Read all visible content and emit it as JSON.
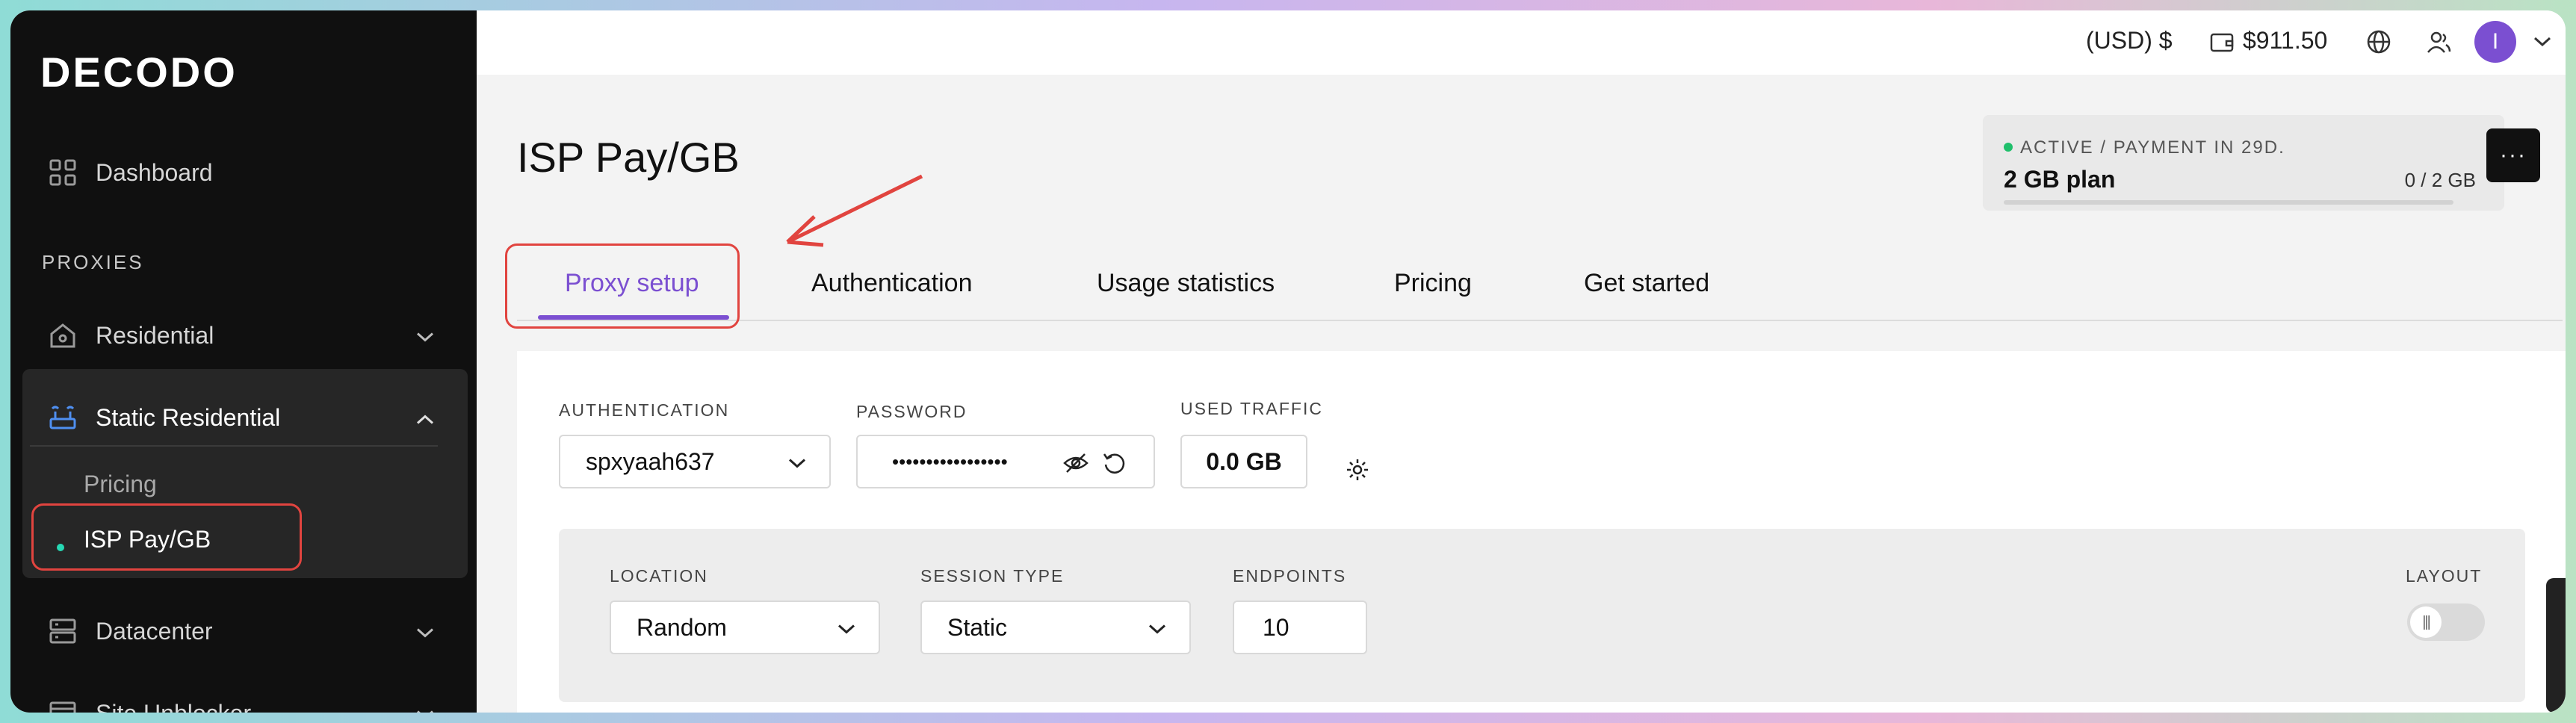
{
  "brand": {
    "logo_text": "DECODO"
  },
  "sidebar": {
    "dashboard_label": "Dashboard",
    "section_label": "PROXIES",
    "items": [
      {
        "label": "Residential"
      },
      {
        "label": "Static Residential"
      },
      {
        "label": "Datacenter"
      },
      {
        "label": "Site Unblocker"
      }
    ],
    "sub_items": [
      {
        "label": "Pricing"
      },
      {
        "label": "ISP Pay/GB"
      }
    ]
  },
  "topbar": {
    "currency": "(USD) $",
    "balance": "$911.50",
    "avatar_letter": "I"
  },
  "page": {
    "title": "ISP Pay/GB",
    "plan": {
      "status": "ACTIVE / PAYMENT IN 29D.",
      "name": "2 GB plan",
      "usage": "0 / 2 GB",
      "usage_fraction": 0
    },
    "more_label": "···",
    "tabs": [
      {
        "label": "Proxy setup"
      },
      {
        "label": "Authentication"
      },
      {
        "label": "Usage statistics"
      },
      {
        "label": "Pricing"
      },
      {
        "label": "Get started"
      }
    ]
  },
  "setup": {
    "authentication": {
      "label": "AUTHENTICATION",
      "value": "spxyaah637"
    },
    "password": {
      "label": "PASSWORD",
      "value": "•••••••••••••••••"
    },
    "used_traffic": {
      "label": "USED TRAFFIC",
      "value": "0.0 GB"
    }
  },
  "filters": {
    "location": {
      "label": "LOCATION",
      "value": "Random"
    },
    "session_type": {
      "label": "SESSION TYPE",
      "value": "Static"
    },
    "endpoints": {
      "label": "ENDPOINTS",
      "value": "10"
    },
    "layout": {
      "label": "LAYOUT"
    }
  },
  "colors": {
    "accent": "#7b4fd1",
    "sidebar_bg": "#101010",
    "highlight_red": "#e1443f",
    "active_dot": "#26d9b4"
  }
}
